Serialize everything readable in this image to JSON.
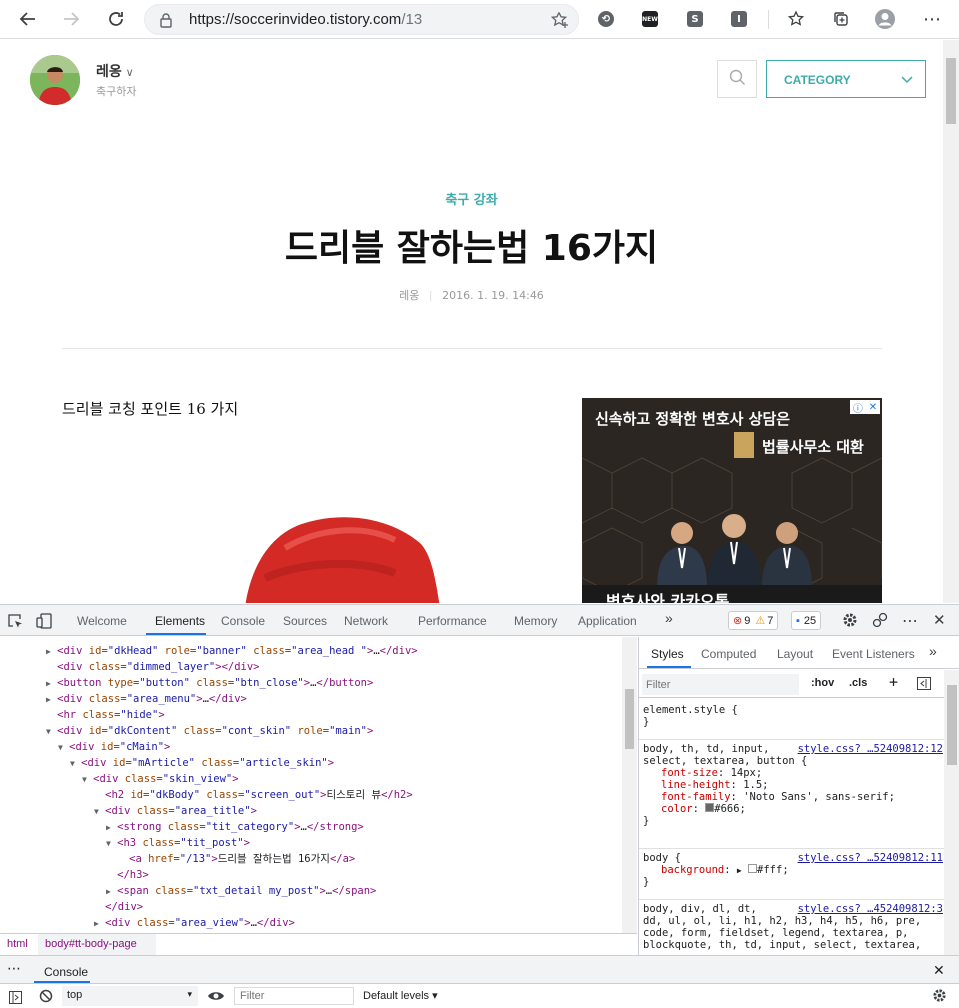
{
  "browser": {
    "url_host": "https://soccerinvideo.tistory.com",
    "url_path": "/13"
  },
  "page": {
    "blog_name": "레옹",
    "blog_desc": "축구하자",
    "category_label": "CATEGORY",
    "post_category": "축구 강좌",
    "post_title": "드리블 잘하는법 16가지",
    "post_author": "레옹",
    "post_date": "2016. 1. 19. 14:46",
    "body_heading": "드리블 코칭 포인트 16 가지",
    "ad_line1": "신속하고 정확한 변호사 상담은",
    "ad_line2": "법률사무소 대환",
    "ad_bottom": "변호사와 카카오톡"
  },
  "devtools": {
    "tabs": [
      "Welcome",
      "Elements",
      "Console",
      "Sources",
      "Network",
      "Performance",
      "Memory",
      "Application"
    ],
    "errors": "9",
    "warnings": "7",
    "messages": "25",
    "elements_lines": [
      {
        "indent": 0,
        "tri": "▶",
        "tag": "div",
        "attrs": [
          [
            "id",
            "dkHead"
          ],
          [
            "role",
            "banner"
          ],
          [
            "class",
            "area_head "
          ]
        ],
        "rest": "…</div>"
      },
      {
        "indent": 0,
        "tri": "",
        "tag": "div",
        "attrs": [
          [
            "class",
            "dimmed_layer"
          ]
        ],
        "rest": "</div>"
      },
      {
        "indent": 0,
        "tri": "▶",
        "tag": "button",
        "attrs": [
          [
            "type",
            "button"
          ],
          [
            "class",
            "btn_close"
          ]
        ],
        "rest": "…</button>"
      },
      {
        "indent": 0,
        "tri": "▶",
        "tag": "div",
        "attrs": [
          [
            "class",
            "area_menu"
          ]
        ],
        "rest": "…</div>"
      },
      {
        "indent": 0,
        "tri": "",
        "tag": "hr",
        "attrs": [
          [
            "class",
            "hide"
          ]
        ],
        "rest": ""
      },
      {
        "indent": 0,
        "tri": "▼",
        "tag": "div",
        "attrs": [
          [
            "id",
            "dkContent"
          ],
          [
            "class",
            "cont_skin"
          ],
          [
            "role",
            "main"
          ]
        ],
        "rest": ""
      },
      {
        "indent": 1,
        "tri": "▼",
        "tag": "div",
        "attrs": [
          [
            "id",
            "cMain"
          ]
        ],
        "rest": ""
      },
      {
        "indent": 2,
        "tri": "▼",
        "tag": "div",
        "attrs": [
          [
            "id",
            "mArticle"
          ],
          [
            "class",
            "article_skin"
          ]
        ],
        "rest": ""
      },
      {
        "indent": 3,
        "tri": "▼",
        "tag": "div",
        "attrs": [
          [
            "class",
            "skin_view"
          ]
        ],
        "rest": ""
      },
      {
        "indent": 4,
        "tri": "",
        "tag": "h2",
        "attrs": [
          [
            "id",
            "dkBody"
          ],
          [
            "class",
            "screen_out"
          ]
        ],
        "rest": "티스토리 뷰</h2>"
      },
      {
        "indent": 4,
        "tri": "▼",
        "tag": "div",
        "attrs": [
          [
            "class",
            "area_title"
          ]
        ],
        "rest": ""
      },
      {
        "indent": 5,
        "tri": "▶",
        "tag": "strong",
        "attrs": [
          [
            "class",
            "tit_category"
          ]
        ],
        "rest": "…</strong>"
      },
      {
        "indent": 5,
        "tri": "▼",
        "tag": "h3",
        "attrs": [
          [
            "class",
            "tit_post"
          ]
        ],
        "rest": ""
      },
      {
        "indent": 6,
        "tri": "",
        "tag": "a",
        "attrs": [
          [
            "href",
            "/13"
          ]
        ],
        "rest": "드리블 잘하는법 16가지</a>"
      },
      {
        "indent": 5,
        "tri": "",
        "tag": "/h3",
        "attrs": [],
        "rest": ""
      },
      {
        "indent": 5,
        "tri": "▶",
        "tag": "span",
        "attrs": [
          [
            "class",
            "txt_detail my_post"
          ]
        ],
        "rest": "…</span>"
      },
      {
        "indent": 4,
        "tri": "",
        "tag": "/div",
        "attrs": [],
        "rest": ""
      },
      {
        "indent": 4,
        "tri": "▶",
        "tag": "div",
        "attrs": [
          [
            "class",
            "area_view"
          ]
        ],
        "rest": "…</div>"
      }
    ],
    "breadcrumb": [
      "html",
      "body#tt-body-page"
    ],
    "styles_tabs": [
      "Styles",
      "Computed",
      "Layout",
      "Event Listeners"
    ],
    "filter_placeholder": "Filter",
    "hov": ":hov",
    "cls": ".cls",
    "rules": {
      "element_style": "element.style {",
      "r1_selector": "body, th, td, input,",
      "r1_selector2": "select, textarea, button {",
      "r1_source": "style.css? …52409812:12",
      "r1_props": [
        [
          "font-size",
          "14px;"
        ],
        [
          "line-height",
          "1.5;"
        ],
        [
          "font-family",
          "'Noto Sans', sans-serif;"
        ],
        [
          "color",
          "#666;"
        ]
      ],
      "r2_selector": "body {",
      "r2_source": "style.css? …52409812:11",
      "r2_prop": "background",
      "r2_val": "#fff;",
      "r3_selector": "body, div, dl, dt,",
      "r3_source": "style.css? …452409812:3",
      "r3_line2": "dd, ul, ol, li, h1, h2, h3, h4, h5, h6, pre,",
      "r3_line3": "code, form, fieldset, legend, textarea, p,",
      "r3_line4": "blockquote, th, td, input, select, textarea,"
    },
    "drawer_tab": "Console",
    "console_context": "top",
    "console_filter_placeholder": "Filter",
    "default_levels": "Default levels ▾"
  }
}
